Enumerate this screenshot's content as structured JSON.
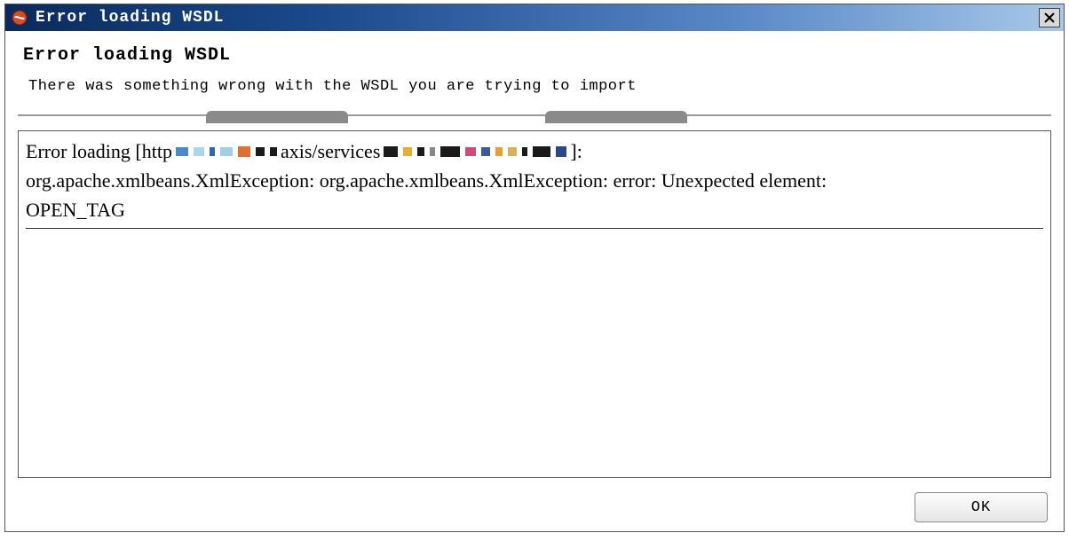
{
  "titlebar": {
    "title": "Error loading WSDL"
  },
  "header": {
    "title": "Error loading WSDL",
    "description": "There was something wrong with the WSDL you are trying to import"
  },
  "error": {
    "pre_url": "Error loading [http",
    "mid_url": "axis/services",
    "post_url": "]:",
    "line2": "org.apache.xmlbeans.XmlException: org.apache.xmlbeans.XmlException: error: Unexpected element:",
    "line3": "OPEN_TAG"
  },
  "buttons": {
    "ok": "OK"
  }
}
